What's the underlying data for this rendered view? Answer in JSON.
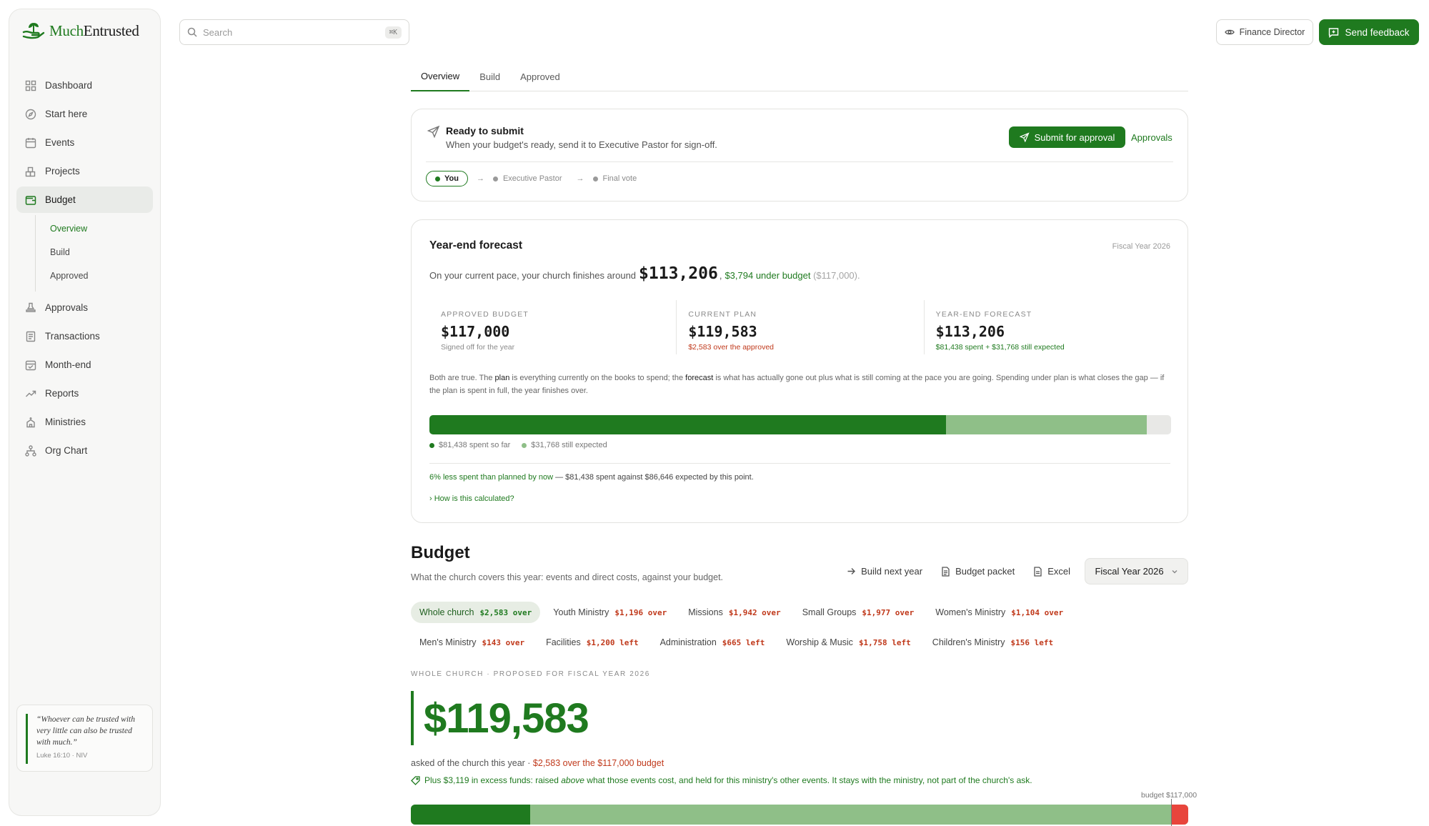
{
  "brand": {
    "name_a": "Much",
    "name_b": "Entrusted"
  },
  "search": {
    "placeholder": "Search",
    "shortcut": "⌘K"
  },
  "topbar": {
    "role_label": "Finance Director",
    "feedback_label": "Send feedback"
  },
  "sidebar": {
    "items": [
      {
        "label": "Dashboard",
        "icon": "grid-icon"
      },
      {
        "label": "Start here",
        "icon": "compass-icon"
      },
      {
        "label": "Events",
        "icon": "calendar-icon"
      },
      {
        "label": "Projects",
        "icon": "blocks-icon"
      },
      {
        "label": "Budget",
        "icon": "wallet-icon"
      },
      {
        "label": "Approvals",
        "icon": "stamp-icon"
      },
      {
        "label": "Transactions",
        "icon": "receipt-icon"
      },
      {
        "label": "Month-end",
        "icon": "calendar-check-icon"
      },
      {
        "label": "Reports",
        "icon": "trend-icon"
      },
      {
        "label": "Ministries",
        "icon": "church-icon"
      },
      {
        "label": "Org Chart",
        "icon": "org-icon"
      }
    ],
    "budget_sub": [
      "Overview",
      "Build",
      "Approved"
    ],
    "quote": {
      "text": "“Whoever can be trusted with very little can also be trusted with much.”",
      "ref": "Luke 16:10 · NIV"
    }
  },
  "tabs": [
    "Overview",
    "Build",
    "Approved"
  ],
  "submit": {
    "title": "Ready to submit",
    "subtitle": "When your budget's ready, send it to Executive Pastor for sign-off.",
    "button": "Submit for approval",
    "link": "Approvals",
    "steps": [
      "You",
      "Executive Pastor",
      "Final vote"
    ],
    "arrow": "→"
  },
  "forecast": {
    "title": "Year-end forecast",
    "fiscal_year": "Fiscal Year 2026",
    "pre": "On your current pace, your church finishes around",
    "big": "$113,206",
    "comma": ",",
    "under": "$3,794 under budget",
    "paren": "($117,000).",
    "metrics": [
      {
        "label": "APPROVED BUDGET",
        "value": "$117,000",
        "note": "Signed off for the year"
      },
      {
        "label": "CURRENT PLAN",
        "value": "$119,583",
        "note": "$2,583 over the approved"
      },
      {
        "label": "YEAR-END FORECAST",
        "value": "$113,206",
        "note": "$81,438 spent + $31,768 still expected"
      }
    ],
    "para_a": "Both are true. The",
    "para_plan": "plan",
    "para_b": "is everything currently on the books to spend; the",
    "para_forecast": "forecast",
    "para_c": "is what has actually gone out plus what is still coming at the pace you are going. Spending under plan is what closes the gap — if the plan is spent in full, the year finishes over.",
    "bar": {
      "scale": 117000,
      "spent": 81438,
      "expected": 31768
    },
    "legend_spent": "$81,438 spent so far",
    "legend_expected": "$31,768 still expected",
    "less_a": "6% less spent than planned by now",
    "less_b": " — $81,438 spent against $86,646 expected by this point.",
    "how": "› How is this calculated?"
  },
  "budget": {
    "title": "Budget",
    "subtitle": "What the church covers this year: events and direct costs, against your budget.",
    "actions": [
      "Build next year",
      "Budget packet",
      "Excel"
    ],
    "fy_select": "Fiscal Year 2026",
    "chips": [
      {
        "name": "Whole church",
        "amount": "$2,583 over",
        "active": true
      },
      {
        "name": "Youth Ministry",
        "amount": "$1,196 over"
      },
      {
        "name": "Missions",
        "amount": "$1,942 over"
      },
      {
        "name": "Small Groups",
        "amount": "$1,977 over"
      },
      {
        "name": "Women's Ministry",
        "amount": "$1,104 over"
      },
      {
        "name": "Men's Ministry",
        "amount": "$143 over"
      },
      {
        "name": "Facilities",
        "amount": "$1,200 left"
      },
      {
        "name": "Administration",
        "amount": "$665 left"
      },
      {
        "name": "Worship & Music",
        "amount": "$1,758 left"
      },
      {
        "name": "Children's Ministry",
        "amount": "$156 left"
      }
    ],
    "section_label": "WHOLE CHURCH · PROPOSED FOR FISCAL YEAR 2026",
    "big": "$119,583",
    "asked_a": "asked of the church this year · ",
    "asked_b": "$2,583 over the $117,000 budget",
    "plus_a": "Plus $3,119 in excess funds: raised",
    "plus_i": "above",
    "plus_b": "what those events cost, and held for this ministry's other events. It stays with the ministry, not part of the church's ask.",
    "budget_marker": "budget $117,000",
    "bar": {
      "total": 119583,
      "budget": 117000,
      "spent": 18400
    },
    "colors": {
      "spent": "#1f7a1f",
      "planned": "#8fbf88",
      "over": "#e8453c"
    }
  }
}
